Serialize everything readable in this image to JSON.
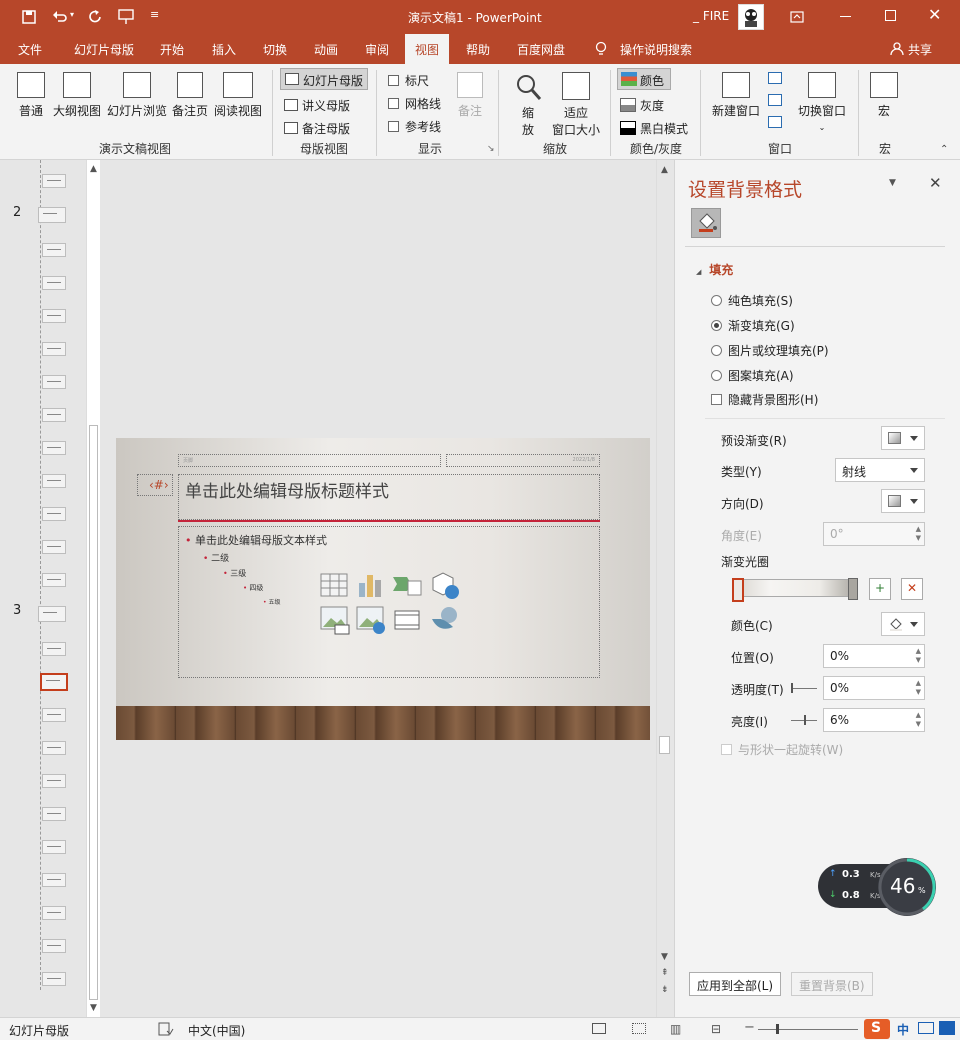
{
  "title_bar": {
    "doc_title": "演示文稿1 - PowerPoint",
    "user_name": "_ FIRE",
    "quick_access": [
      "save-icon",
      "undo-icon",
      "redo-icon",
      "present-from-start-icon",
      "customize-qat-icon"
    ]
  },
  "tabs": [
    "文件",
    "幻灯片母版",
    "开始",
    "插入",
    "切换",
    "动画",
    "审阅",
    "视图",
    "帮助",
    "百度网盘"
  ],
  "active_tab": "视图",
  "tell_me": "操作说明搜索",
  "share": "共享",
  "ribbon": {
    "presentation_views": {
      "label": "演示文稿视图",
      "buttons": [
        "普通",
        "大纲视图",
        "幻灯片浏览",
        "备注页",
        "阅读视图"
      ]
    },
    "master_views": {
      "label": "母版视图",
      "buttons": [
        "幻灯片母版",
        "讲义母版",
        "备注母版"
      ]
    },
    "show": {
      "label": "显示",
      "items": [
        "标尺",
        "网格线",
        "参考线"
      ],
      "notes": "备注"
    },
    "zoom": {
      "label": "缩放",
      "zoom_line1": "缩",
      "zoom_line2": "放",
      "fit_line1": "适应",
      "fit_line2": "窗口大小"
    },
    "color": {
      "label": "颜色/灰度",
      "items": [
        "颜色",
        "灰度",
        "黑白模式"
      ]
    },
    "window": {
      "label": "窗口",
      "new_window": "新建窗口",
      "switch_window": "切换窗口"
    },
    "macro": {
      "label": "宏",
      "button": "宏"
    }
  },
  "thumbnails": {
    "labels": [
      "2",
      "3"
    ]
  },
  "slide": {
    "title": "单击此处编辑母版标题样式",
    "slide_number": "‹#›",
    "footer_left": "页脚",
    "footer_right": "2022/1/8",
    "levels": [
      "单击此处编辑母版文本样式",
      "二级",
      "三级",
      "四级",
      "五级"
    ]
  },
  "format_panel": {
    "title": "设置背景格式",
    "section": "填充",
    "fill_options": [
      "纯色填充(S)",
      "渐变填充(G)",
      "图片或纹理填充(P)",
      "图案填充(A)"
    ],
    "selected_fill": "渐变填充(G)",
    "hide_bg": "隐藏背景图形(H)",
    "preset_label": "预设渐变(R)",
    "type_label": "类型(Y)",
    "type_value": "射线",
    "direction_label": "方向(D)",
    "angle_label": "角度(E)",
    "angle_value": "0°",
    "stops_label": "渐变光圈",
    "color_label": "颜色(C)",
    "position_label": "位置(O)",
    "position_value": "0%",
    "transparency_label": "透明度(T)",
    "transparency_value": "0%",
    "brightness_label": "亮度(I)",
    "brightness_value": "6%",
    "rotate_label": "与形状一起旋转(W)",
    "apply_all": "应用到全部(L)",
    "reset_bg": "重置背景(B)"
  },
  "network_widget": {
    "up": "0.3",
    "down": "0.8",
    "unit": "K/s",
    "percent": "46",
    "percent_sign": "%"
  },
  "status": {
    "mode": "幻灯片母版",
    "language": "中文(中国)",
    "ime": "中"
  },
  "colors": {
    "accent": "#b7472a",
    "title_red": "#b7472a",
    "selected_border": "#c43e1c"
  }
}
